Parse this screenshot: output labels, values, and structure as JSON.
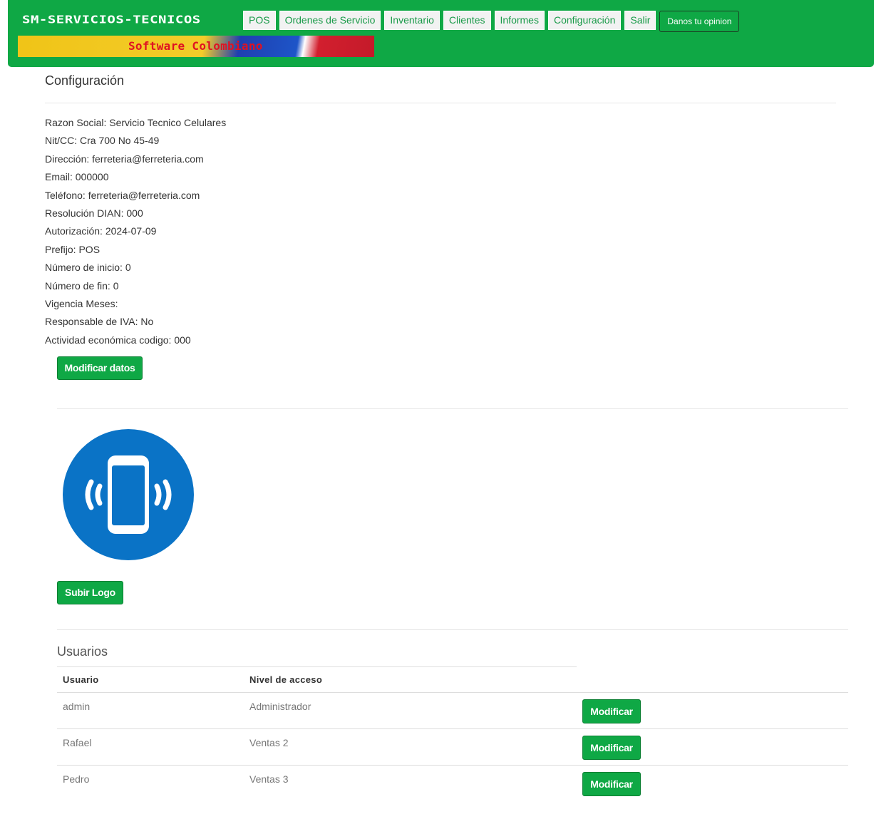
{
  "header": {
    "brand": "SM-SERVICIOS-TECNICOS",
    "nav": [
      "POS",
      "Ordenes de Servicio",
      "Inventario",
      "Clientes",
      "Informes",
      "Configuración",
      "Salir"
    ],
    "feedback_button": "Danos tu opinion",
    "banner_text": "Software Colombiano"
  },
  "page": {
    "title": "Configuración",
    "info": [
      "Razon Social: Servicio Tecnico Celulares",
      "Nit/CC: Cra 700 No 45-49",
      "Dirección: ferreteria@ferreteria.com",
      "Email: 000000",
      "Teléfono: ferreteria@ferreteria.com",
      "Resolución DIAN: 000",
      "Autorización: 2024-07-09",
      "Prefijo: POS",
      "Número de inicio: 0",
      "Número de fin: 0",
      "Vigencia Meses:",
      "Responsable de IVA: No",
      "Actividad económica codigo: 000"
    ],
    "modify_button": "Modificar datos",
    "upload_logo_button": "Subir Logo",
    "logo_icon": "phone-vibrate-icon"
  },
  "users": {
    "title": "Usuarios",
    "headers": {
      "user": "Usuario",
      "level": "Nivel de acceso"
    },
    "rows": [
      {
        "user": "admin",
        "level": "Administrador",
        "action": "Modificar"
      },
      {
        "user": "Rafael",
        "level": "Ventas 2",
        "action": "Modificar"
      },
      {
        "user": "Pedro",
        "level": "Ventas 3",
        "action": "Modificar"
      }
    ]
  },
  "colors": {
    "primary_green": "#0fa845",
    "logo_blue": "#0a73c6",
    "banner_red": "#e01222"
  }
}
